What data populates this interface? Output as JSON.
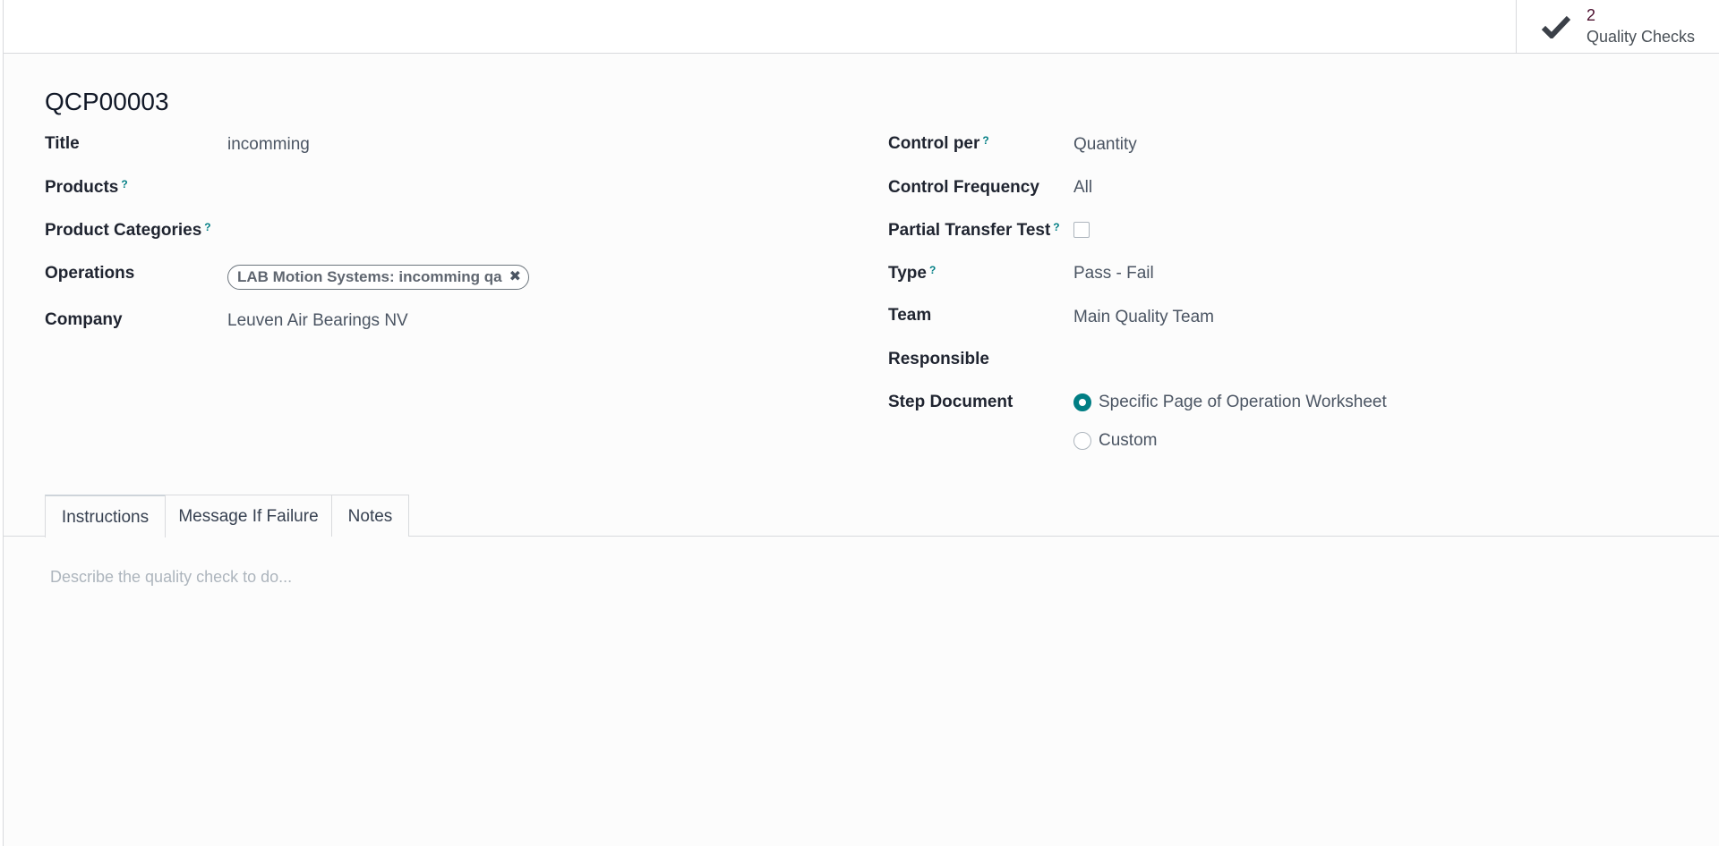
{
  "stat_button": {
    "value": "2",
    "label": "Quality Checks",
    "icon": "check-icon"
  },
  "record": {
    "name": "QCP00003"
  },
  "left_fields": {
    "title_label": "Title",
    "title_value": "incomming",
    "products_label": "Products",
    "product_categories_label": "Product Categories",
    "operations_label": "Operations",
    "operations_tag": "LAB Motion Systems: incomming qa",
    "company_label": "Company",
    "company_value": "Leuven Air Bearings NV"
  },
  "right_fields": {
    "control_per_label": "Control per",
    "control_per_value": "Quantity",
    "control_frequency_label": "Control Frequency",
    "control_frequency_value": "All",
    "partial_transfer_label": "Partial Transfer Test",
    "partial_transfer_checked": false,
    "type_label": "Type",
    "type_value": "Pass - Fail",
    "team_label": "Team",
    "team_value": "Main Quality Team",
    "responsible_label": "Responsible",
    "responsible_value": "",
    "step_document_label": "Step Document",
    "step_document_options": [
      {
        "label": "Specific Page of Operation Worksheet",
        "checked": true
      },
      {
        "label": "Custom",
        "checked": false
      }
    ]
  },
  "help_marker": "?",
  "tabs": [
    {
      "label": "Instructions",
      "active": true
    },
    {
      "label": "Message If Failure",
      "active": false
    },
    {
      "label": "Notes",
      "active": false
    }
  ],
  "instructions": {
    "placeholder": "Describe the quality check to do..."
  },
  "colors": {
    "accent": "#017e84",
    "stat_value": "#4c0f2e"
  }
}
